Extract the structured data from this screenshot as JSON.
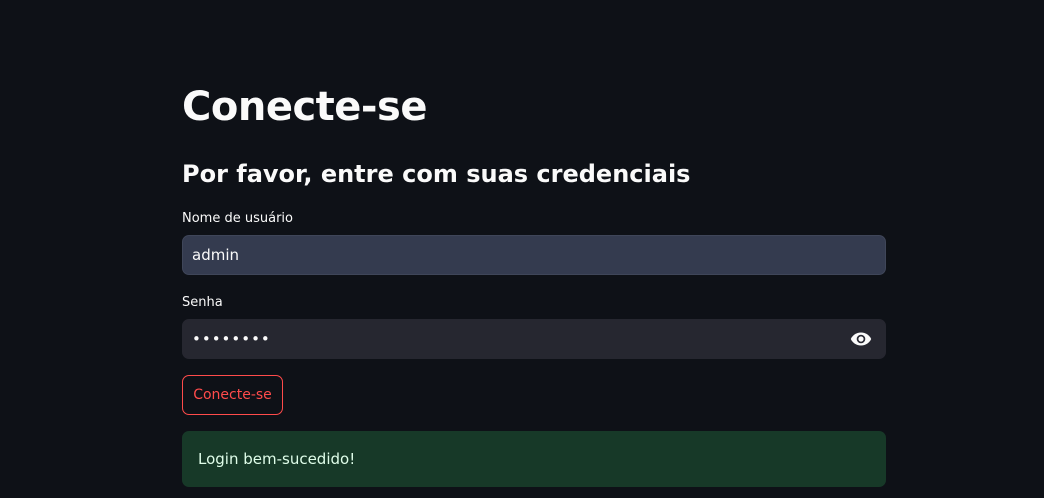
{
  "page": {
    "title": "Conecte-se",
    "subtitle": "Por favor, entre com suas credenciais"
  },
  "form": {
    "username": {
      "label": "Nome de usuário",
      "value": "admin"
    },
    "password": {
      "label": "Senha",
      "value": "password"
    },
    "submit_label": "Conecte-se"
  },
  "alert": {
    "type": "success",
    "message": "Login bem-sucedido!"
  },
  "colors": {
    "background": "#0e1117",
    "accent": "#ff4b4b",
    "success_bg": "#173928",
    "success_text": "#dffde9"
  }
}
